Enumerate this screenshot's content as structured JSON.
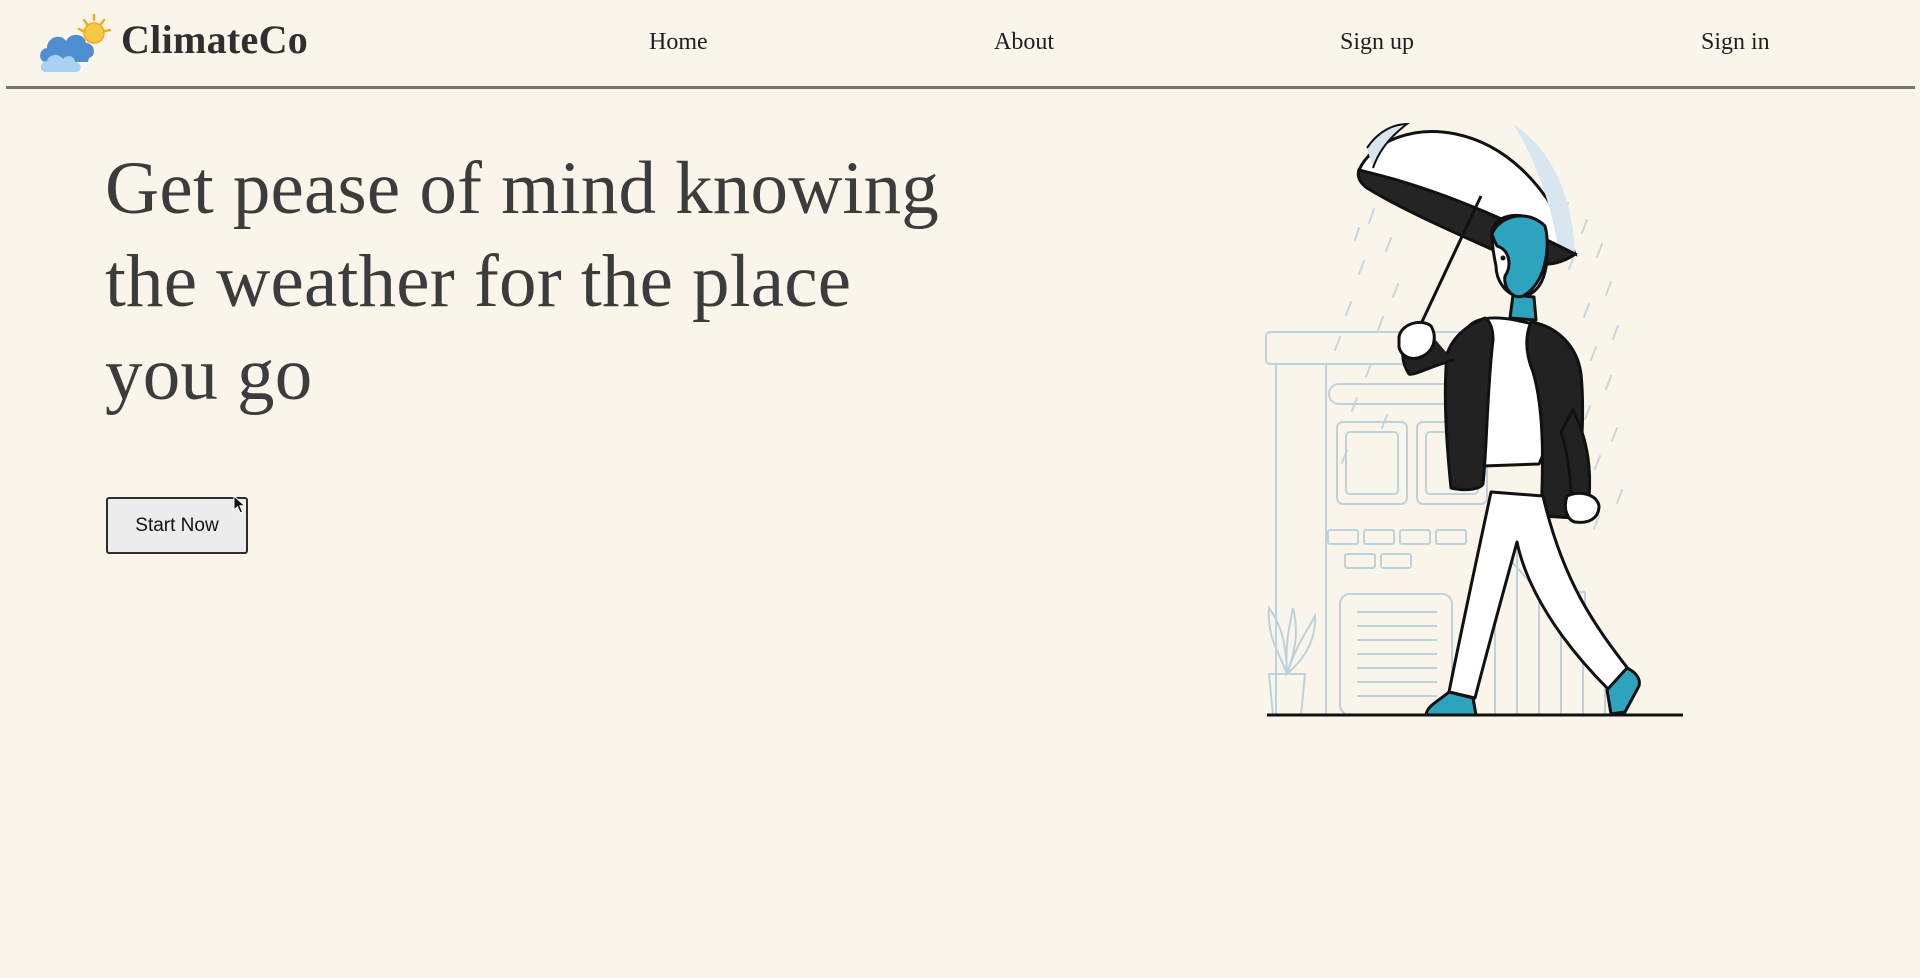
{
  "header": {
    "logo_icon": "cloud-sun-icon",
    "brand": "ClimateCo",
    "nav": {
      "home": "Home",
      "about": "About",
      "sign_up": "Sign up",
      "sign_in": "Sign in"
    }
  },
  "hero": {
    "headline": "Get pease of mind knowing the weather for the place you go",
    "cta_label": "Start Now",
    "illustration": "man-with-umbrella-in-rain-illustration"
  },
  "colors": {
    "background": "#f9f5eb",
    "headline": "#3c3c3c",
    "divider": "#7b7669",
    "accent_teal": "#2ea3be",
    "cloud_blue": "#5b9bd5",
    "sun_yellow": "#f6c945",
    "jacket": "#222222",
    "scene_lines": "#bcd3dc"
  },
  "cursor": "pointer-arrow-icon"
}
